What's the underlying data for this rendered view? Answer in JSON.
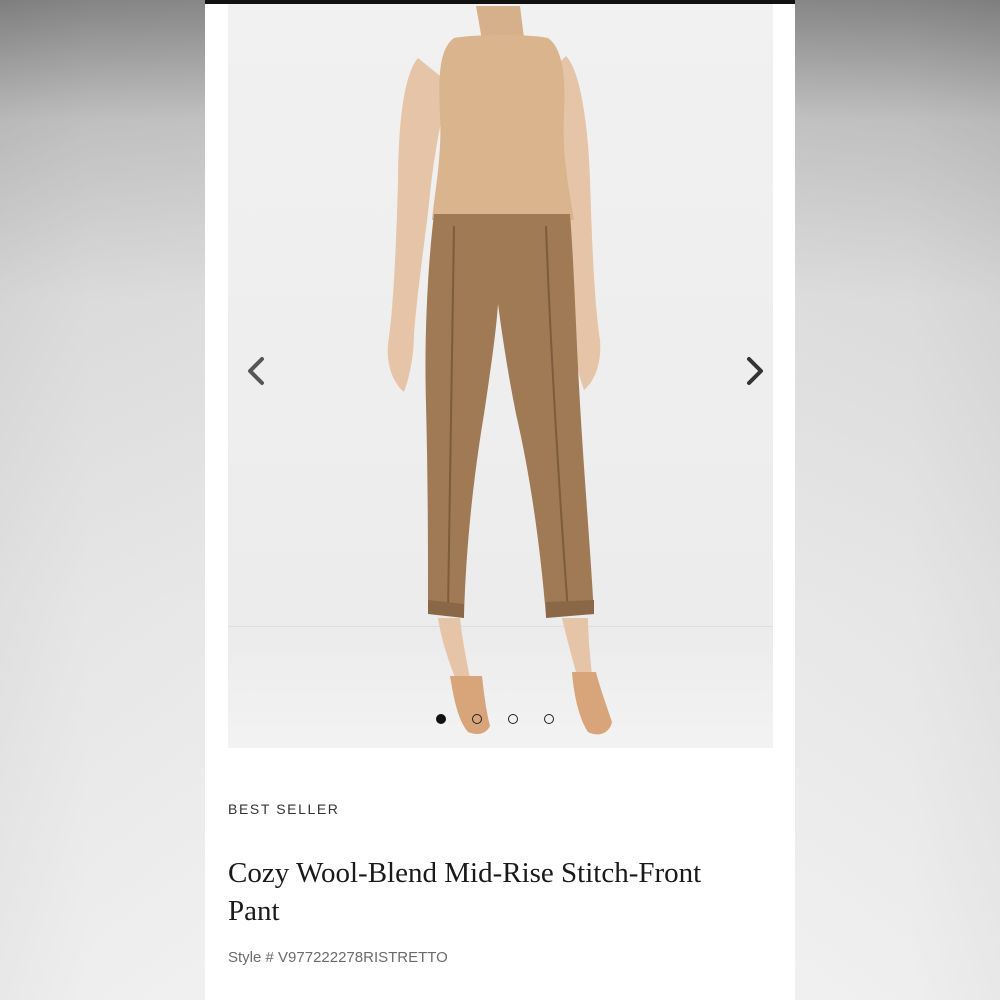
{
  "product": {
    "badge": "BEST SELLER",
    "title": "Cozy Wool-Blend Mid-Rise Stitch-Front Pant",
    "style_label": "Style #",
    "style_number": "V977222278RISTRETTO"
  },
  "gallery": {
    "image_count": 4,
    "active_index": 0,
    "icons": {
      "prev": "chevron-left-icon",
      "next": "chevron-right-icon"
    }
  },
  "colors": {
    "page_bg": "#ffffff",
    "photo_bg": "#f0f0f0",
    "pant": "#a07a55",
    "top": "#d9b48d",
    "text": "#1a1a1a",
    "subtext": "#6b6b6b"
  }
}
